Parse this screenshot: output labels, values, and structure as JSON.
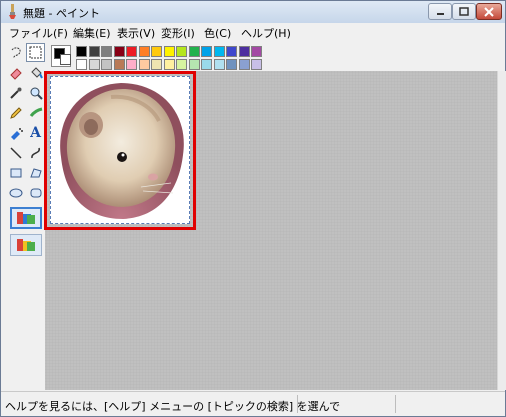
{
  "window": {
    "title": "無題 - ペイント"
  },
  "menu": [
    {
      "label": "ファイル(F)"
    },
    {
      "label": "編集(E)"
    },
    {
      "label": "表示(V)"
    },
    {
      "label": "変形(I)"
    },
    {
      "label": "色(C)"
    },
    {
      "label": "ヘルプ(H)"
    }
  ],
  "tools": [
    {
      "name": "free-form-select-tool"
    },
    {
      "name": "rect-select-tool"
    },
    {
      "name": "eraser-tool"
    },
    {
      "name": "fill-tool"
    },
    {
      "name": "pick-color-tool"
    },
    {
      "name": "magnifier-tool"
    },
    {
      "name": "pencil-tool"
    },
    {
      "name": "brush-tool"
    },
    {
      "name": "airbrush-tool"
    },
    {
      "name": "text-tool",
      "glyph": "A"
    },
    {
      "name": "line-tool"
    },
    {
      "name": "curve-tool"
    },
    {
      "name": "rectangle-tool"
    },
    {
      "name": "polygon-tool"
    },
    {
      "name": "ellipse-tool"
    },
    {
      "name": "rounded-rect-tool"
    }
  ],
  "palette": {
    "foreground": "#000000",
    "background": "#ffffff",
    "row1": [
      "#000000",
      "#404040",
      "#7f7f7f",
      "#880015",
      "#ed1c24",
      "#ff7f27",
      "#ffc90e",
      "#fff200",
      "#b5e61d",
      "#22b14c",
      "#00a2e8",
      "#00b7ef",
      "#3f48cc",
      "#4d2f9f",
      "#a349a4"
    ],
    "row2": [
      "#ffffff",
      "#d8d8d8",
      "#c3c3c3",
      "#b97a57",
      "#ffaec9",
      "#ffc9a0",
      "#efe4b0",
      "#fff0a0",
      "#d6f3a0",
      "#b5e6b0",
      "#99d9ea",
      "#b0e0ef",
      "#7092be",
      "#8aa0d0",
      "#c8bfe7"
    ]
  },
  "highlight_color": "#e00000",
  "status": {
    "text": "ヘルプを見るには、[ヘルプ] メニューの [トピックの検索] を選んで"
  }
}
